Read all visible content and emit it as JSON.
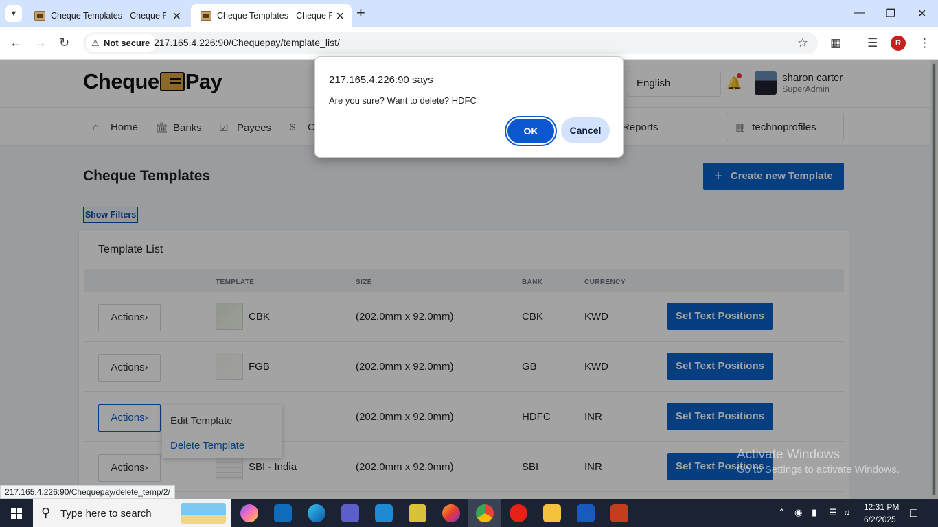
{
  "browser": {
    "tabs": [
      {
        "title": "Cheque Templates - Cheque Pa",
        "active": false
      },
      {
        "title": "Cheque Templates - Cheque Pa",
        "active": true
      }
    ],
    "security_label": "Not secure",
    "url": "217.165.4.226:90/Chequepay/template_list/",
    "profile_initial": "R",
    "status_url": "217.165.4.226:90/Chequepay/delete_temp/2/"
  },
  "header": {
    "logo_left": "Cheque",
    "logo_right": "Pay",
    "language": "English",
    "user_name": "sharon carter",
    "user_role": "SuperAdmin"
  },
  "menu": {
    "items": [
      {
        "label": "Home",
        "icon": "home-icon"
      },
      {
        "label": "Banks",
        "icon": "bank-icon"
      },
      {
        "label": "Payees",
        "icon": "checkbox-icon"
      },
      {
        "label": "C",
        "icon": "dollar-icon"
      },
      {
        "label": "Reports",
        "icon": "report-icon"
      }
    ],
    "company": "technoprofiles"
  },
  "main": {
    "title": "Cheque Templates",
    "create_button": "Create new Template",
    "filters_button": "Show Filters",
    "card_title": "Template List",
    "columns": [
      "TEMPLATE",
      "SIZE",
      "BANK",
      "CURRENCY"
    ],
    "rows": [
      {
        "actions": "Actions",
        "template": "CBK",
        "size": "(202.0mm x 92.0mm)",
        "bank": "CBK",
        "currency": "KWD",
        "button": "Set Text Positions"
      },
      {
        "actions": "Actions",
        "template": "FGB",
        "size": "(202.0mm x 92.0mm)",
        "bank": "GB",
        "currency": "KWD",
        "button": "Set Text Positions"
      },
      {
        "actions": "Actions",
        "template": "",
        "size": "(202.0mm x 92.0mm)",
        "bank": "HDFC",
        "currency": "INR",
        "button": "Set Text Positions"
      },
      {
        "actions": "Actions",
        "template": "SBI - India",
        "size": "(202.0mm x 92.0mm)",
        "bank": "SBI",
        "currency": "INR",
        "button": "Set Text Positions"
      }
    ],
    "dropdown": {
      "edit": "Edit Template",
      "delete": "Delete Template"
    }
  },
  "dialog": {
    "title": "217.165.4.226:90 says",
    "message": "Are you sure? Want to delete? HDFC",
    "ok": "OK",
    "cancel": "Cancel"
  },
  "watermark": {
    "line1": "Activate Windows",
    "line2": "Go to Settings to activate Windows."
  },
  "taskbar": {
    "search_placeholder": "Type here to search",
    "time": "12:31 PM",
    "date": "6/2/2025"
  },
  "colors": {
    "primary": "#0b61c9",
    "dialog_ok": "#0b57d0",
    "chrome_tabbar": "#d3e3fd",
    "taskbar": "#1b2333"
  }
}
